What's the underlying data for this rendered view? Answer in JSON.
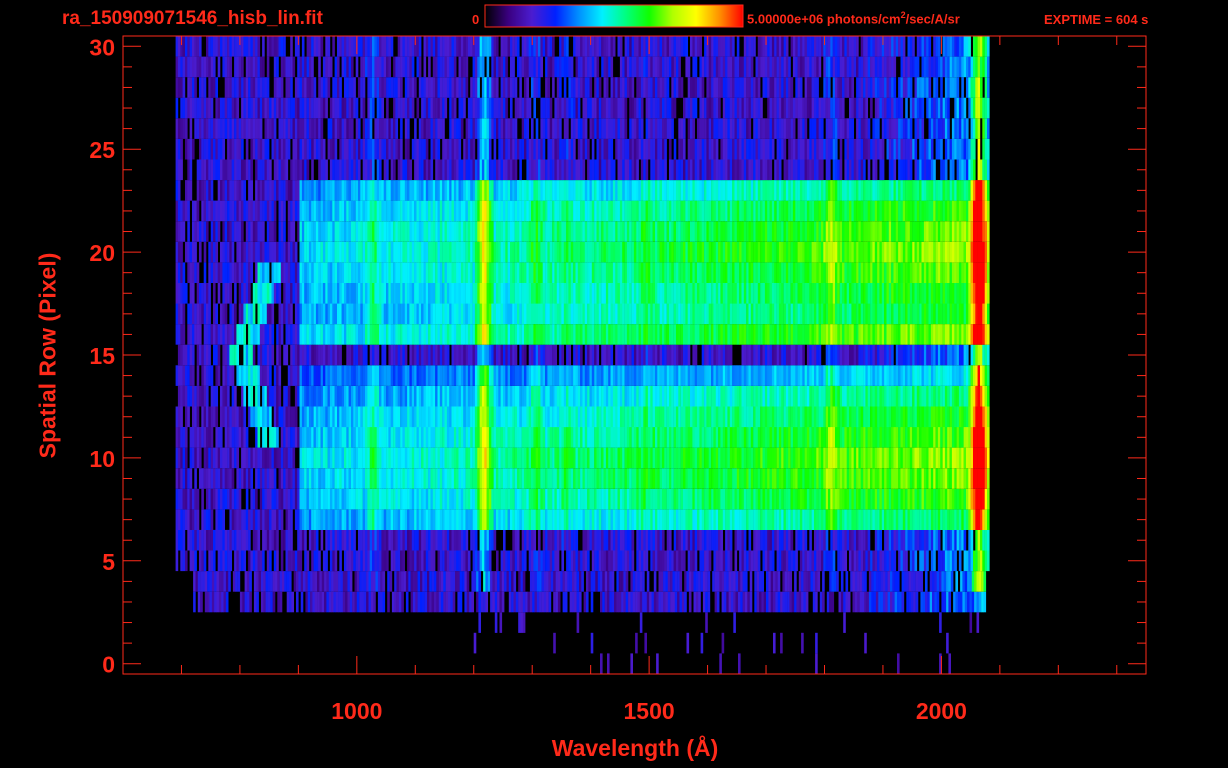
{
  "header": {
    "filename": "ra_150909071546_hisb_lin.fit",
    "colorbar_min_label": "0",
    "colorbar_max_value": "5.00000e+06 photons/cm",
    "colorbar_max_exp": "2",
    "colorbar_max_rest": "/sec/A/sr",
    "exptime": "EXPTIME = 604 s"
  },
  "colors": {
    "text_axes": "#ff2a1a",
    "background": "#000000",
    "colormap": [
      "#000000",
      "#3a0080",
      "#4b1cd0",
      "#0020ff",
      "#0090ff",
      "#00f0ff",
      "#00ff80",
      "#10ff00",
      "#b0ff00",
      "#ffff00",
      "#ff9000",
      "#ff0000"
    ]
  },
  "chart_data": {
    "type": "heatmap",
    "title": "ra_150909071546_hisb_lin.fit",
    "xlabel": "Wavelength (Å)",
    "ylabel": "Spatial Row (Pixel)",
    "xlim": [
      600,
      2350
    ],
    "ylim": [
      -0.5,
      30.5
    ],
    "xticks": [
      1000,
      1500,
      2000
    ],
    "xtick_labels": [
      "1000",
      "1500",
      "2000"
    ],
    "yticks": [
      0,
      5,
      10,
      15,
      20,
      25,
      30
    ],
    "ytick_labels": [
      "0",
      "5",
      "10",
      "15",
      "20",
      "25",
      "30"
    ],
    "colorbar": {
      "min": 0,
      "max": 5000000,
      "units": "photons/cm^2/sec/A/sr"
    },
    "bright_rows": [
      7,
      8,
      9,
      10,
      11,
      12,
      13,
      14,
      16,
      17,
      18,
      19,
      20,
      21,
      22,
      23
    ],
    "bright_row_level": [
      0.38,
      0.46,
      0.5,
      0.52,
      0.47,
      0.42,
      0.36,
      0.25,
      0.5,
      0.41,
      0.44,
      0.48,
      0.52,
      0.49,
      0.45,
      0.36
    ],
    "emission_lines": [
      {
        "wavelength": 1026,
        "level": 0.12
      },
      {
        "wavelength": 1216,
        "level": 0.36
      },
      {
        "wavelength": 1304,
        "level": 0.1
      },
      {
        "wavelength": 1356,
        "level": 0.05
      },
      {
        "wavelength": 1493,
        "level": 0.05
      },
      {
        "wavelength": 1810,
        "level": 0.12
      },
      {
        "wavelength": 2062,
        "level": 0.55
      }
    ],
    "wavelength_coverage": [
      690,
      2080
    ]
  }
}
